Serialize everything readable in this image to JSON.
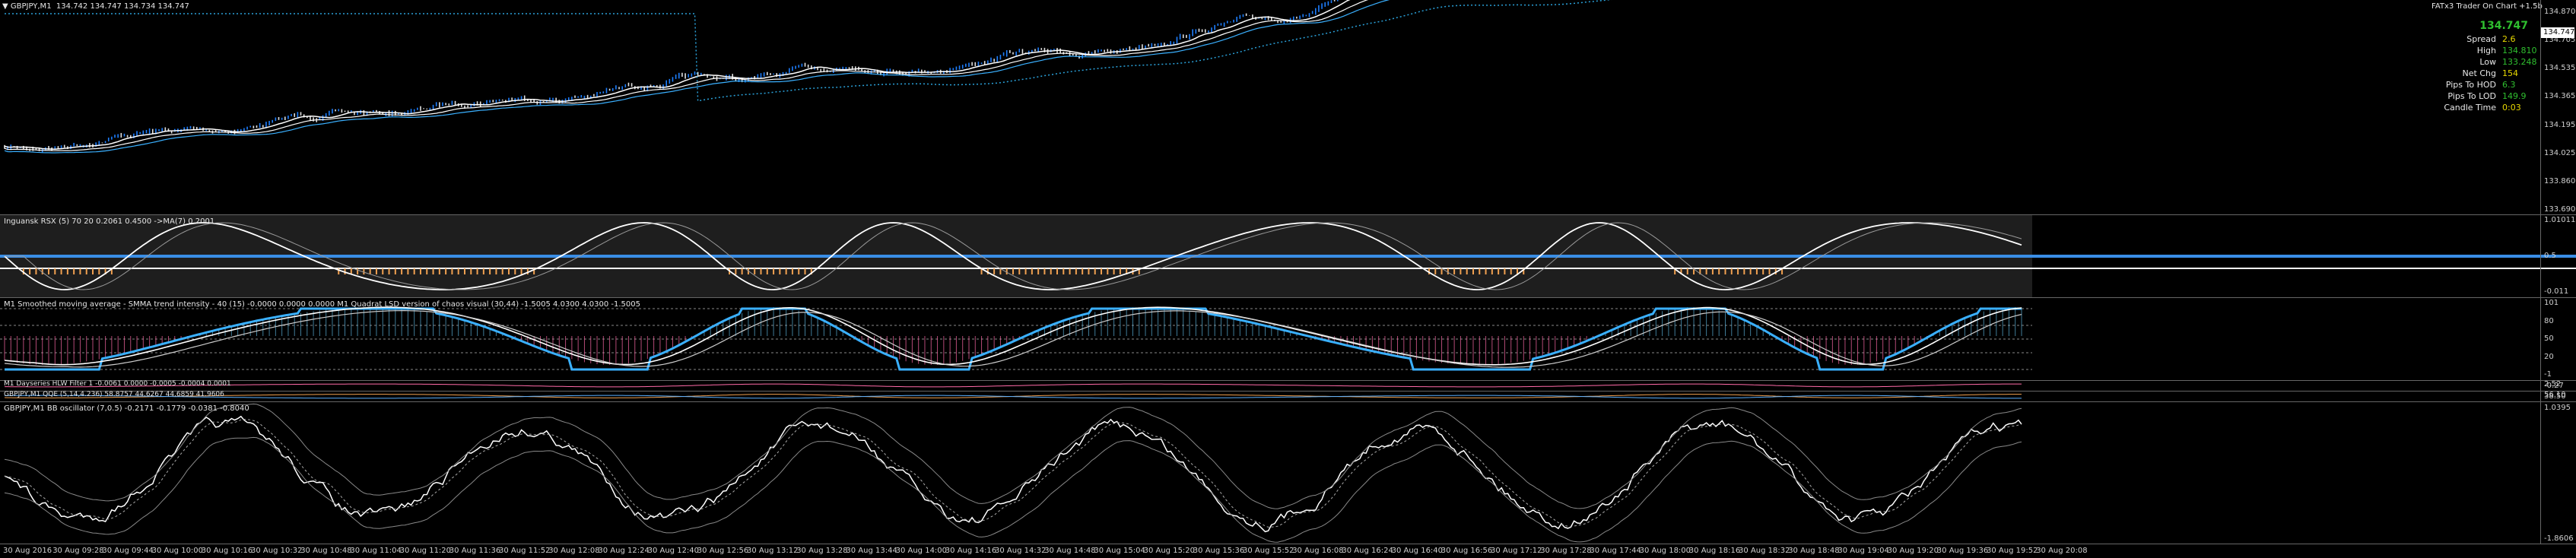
{
  "header": {
    "title": "GBPJPY,M1",
    "ohlc": "134.742 134.747 134.734 134.747",
    "indicator_brand": "FATx3 Trader On Chart +1.5b"
  },
  "info_panel": {
    "big_price": "134.747",
    "rows": [
      {
        "key": "Spread",
        "value": "2.6",
        "color": "#e8d800"
      },
      {
        "key": "High",
        "value": "134.810",
        "color": "#2fbf2f"
      },
      {
        "key": "Low",
        "value": "133.248",
        "color": "#2fbf2f"
      },
      {
        "key": "Net Chg",
        "value": "154",
        "color": "#e8d800"
      },
      {
        "key": "Pips To HOD",
        "value": "6.3",
        "color": "#2fbf2f"
      },
      {
        "key": "Pips To LOD",
        "value": "149.9",
        "color": "#2fbf2f"
      },
      {
        "key": "Candle Time",
        "value": "0:03",
        "color": "#e8d800"
      }
    ]
  },
  "price_axis": [
    "134.870",
    "134.705",
    "134.535",
    "134.365",
    "134.195",
    "134.025",
    "133.860",
    "133.690"
  ],
  "price_box": "134.747",
  "sub1": {
    "label": "Inguansk RSX (5) 70 20 0.2061 0.4500 ->MA(7) 0.2001",
    "axis": [
      "1.01011",
      "0.5",
      "-0.011"
    ]
  },
  "sub2": {
    "label": "M1 Smoothed moving average - SMMA trend intensity - 40 (15) -0.0000 0.0000 0.0000  M1 Quadrat LSD version of chaos visual (30,44) -1.5005 4.0300 4.0300 -1.5005",
    "axis": [
      "101",
      "80",
      "50",
      "20",
      "-1"
    ]
  },
  "sub3": {
    "label": "M1 Dayseries HLW Filter 1 -0.0061 0.0000 -0.0005 -0.0004 0.0001",
    "axis": [
      "2.52",
      "-0.27"
    ]
  },
  "sub4": {
    "label": "GBPJPY,M1 QQE (5,14,4.236) 58.8757 44.6267 44.6859 41.9606",
    "axis": [
      "56.10",
      "38.50"
    ]
  },
  "sub5": {
    "label": "GBPJPY,M1  BB oscillator (7,0.5) -0.2171 -0.1779 -0.0381 -0.8040",
    "axis": [
      "1.0395",
      "-1.8606"
    ]
  },
  "time_axis": [
    "30 Aug 2016",
    "30 Aug 09:28",
    "30 Aug 09:44",
    "30 Aug 10:00",
    "30 Aug 10:16",
    "30 Aug 10:32",
    "30 Aug 10:48",
    "30 Aug 11:04",
    "30 Aug 11:20",
    "30 Aug 11:36",
    "30 Aug 11:52",
    "30 Aug 12:08",
    "30 Aug 12:24",
    "30 Aug 12:40",
    "30 Aug 12:56",
    "30 Aug 13:12",
    "30 Aug 13:28",
    "30 Aug 13:44",
    "30 Aug 14:00",
    "30 Aug 14:16",
    "30 Aug 14:32",
    "30 Aug 14:48",
    "30 Aug 15:04",
    "30 Aug 15:20",
    "30 Aug 15:36",
    "30 Aug 15:52",
    "30 Aug 16:08",
    "30 Aug 16:24",
    "30 Aug 16:40",
    "30 Aug 16:56",
    "30 Aug 17:12",
    "30 Aug 17:28",
    "30 Aug 17:44",
    "30 Aug 18:00",
    "30 Aug 18:16",
    "30 Aug 18:32",
    "30 Aug 18:48",
    "30 Aug 19:04",
    "30 Aug 19:20",
    "30 Aug 19:36",
    "30 Aug 19:52",
    "30 Aug 20:08"
  ],
  "colors": {
    "bull_candle": "#1e7fff",
    "bear_candle": "#e0e0e0",
    "ma_white": "#ffffff",
    "ma_cyan": "#3ab0ff",
    "dotted_band": "#2aa0d8",
    "accent_orange": "#f0a050",
    "accent_pink": "#ff6aa8",
    "rsx_fill": "#1e1e1e",
    "rsx_mid": "#3a8ee6"
  }
}
